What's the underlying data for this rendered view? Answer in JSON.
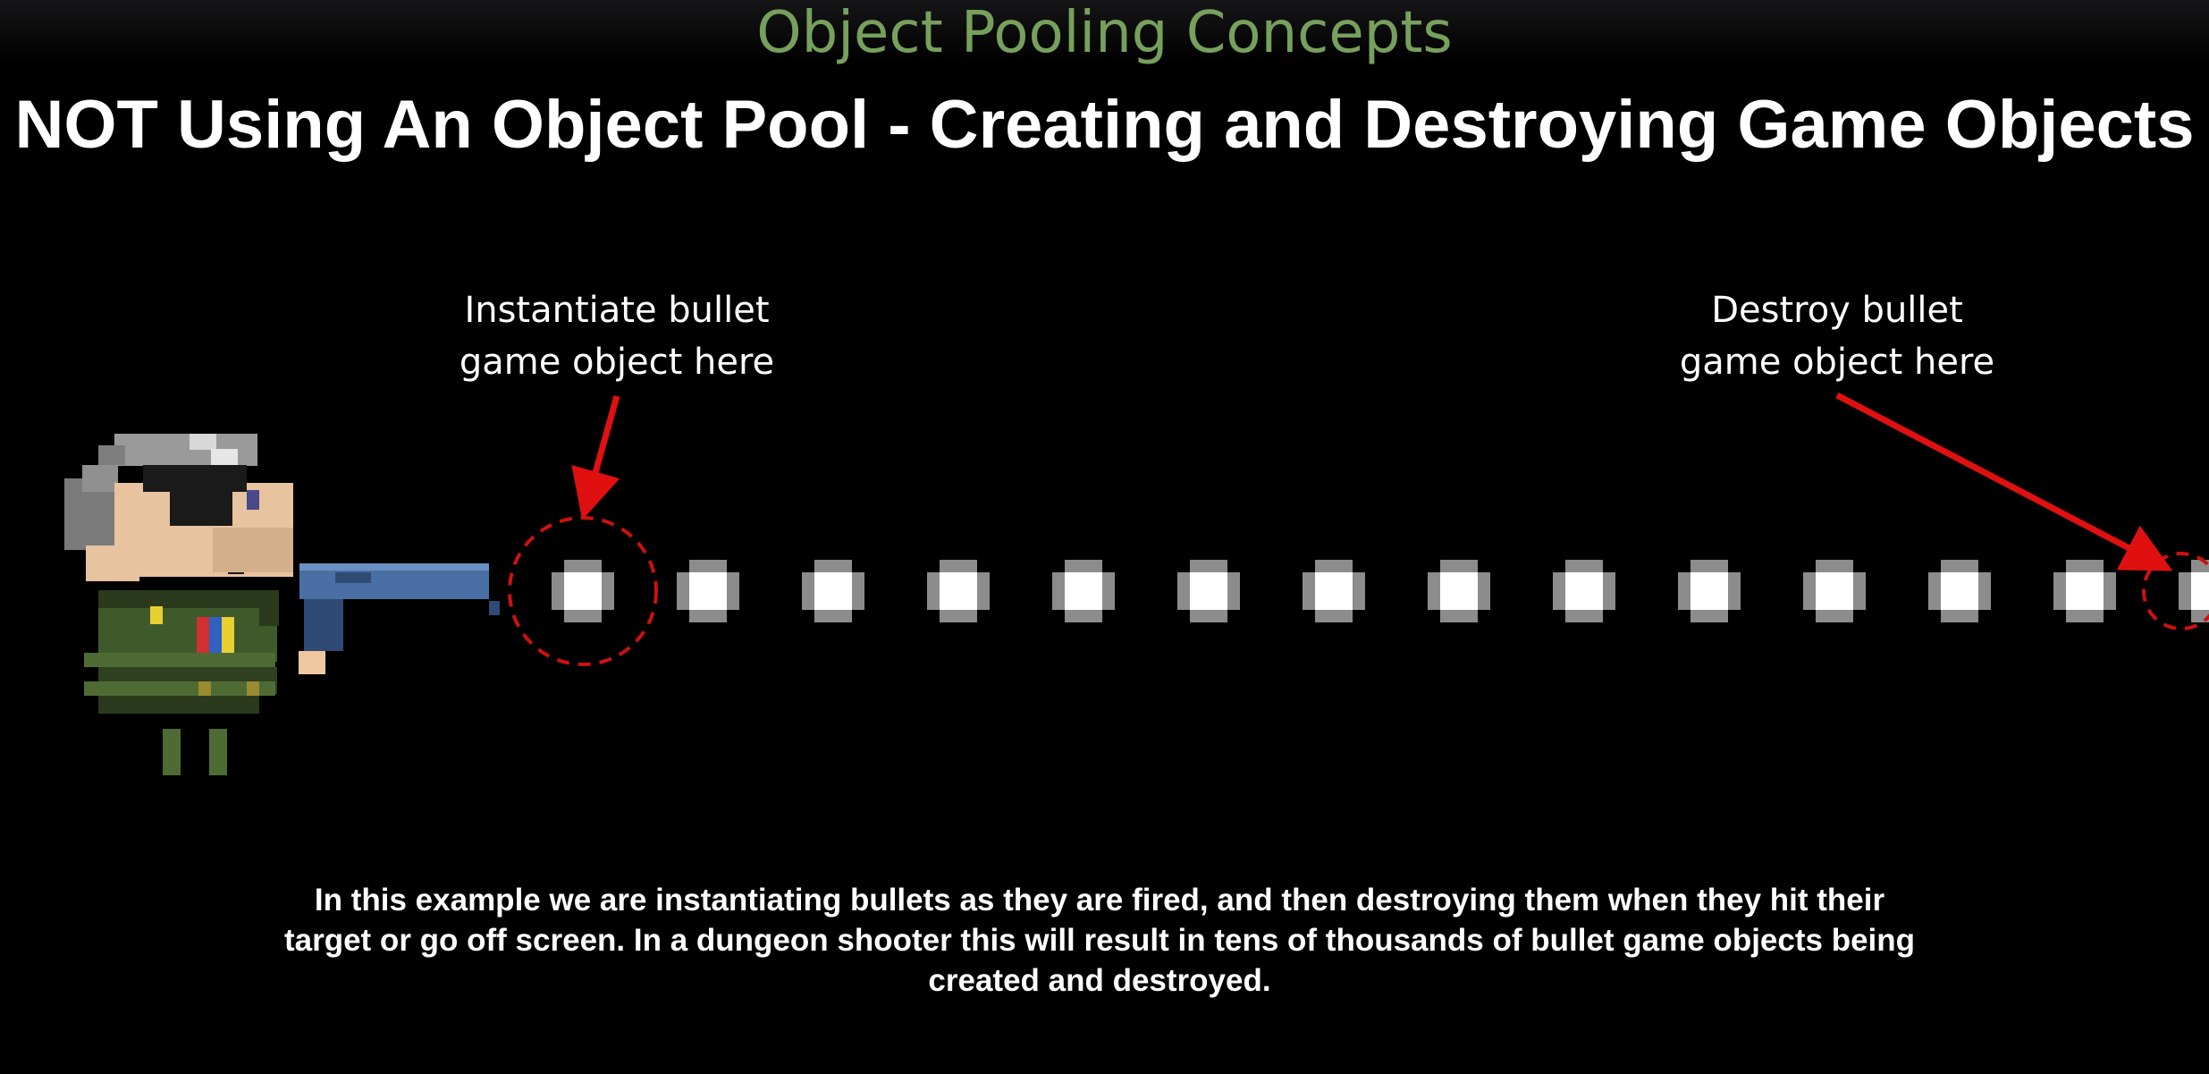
{
  "slide": {
    "subtitle": "Object Pooling Concepts",
    "title": "NOT Using An Object Pool - Creating and Destroying Game Objects",
    "callouts": {
      "instantiate": {
        "line1": "Instantiate bullet",
        "line2": "game object here"
      },
      "destroy": {
        "line1": "Destroy bullet",
        "line2": "game object here"
      }
    },
    "caption": {
      "line1": "In this example we are instantiating bullets as they are fired, and then destroying them when they hit their",
      "line2": "target or go off screen.  In a dungeon shooter this will result in tens of thousands of bullet game objects being",
      "line3": "created and destroyed."
    }
  },
  "scene": {
    "bullet_count": 14,
    "colors": {
      "background": "#000000",
      "subtitle": "#77a05c",
      "text": "#ffffff",
      "arrow": "#e01010",
      "marker_circle": "#cc1111",
      "bullet_core": "#ffffff",
      "bullet_edge": "#8c8c8c",
      "gun": "#4a6fa5",
      "uniform": "#3f5a2a"
    }
  }
}
